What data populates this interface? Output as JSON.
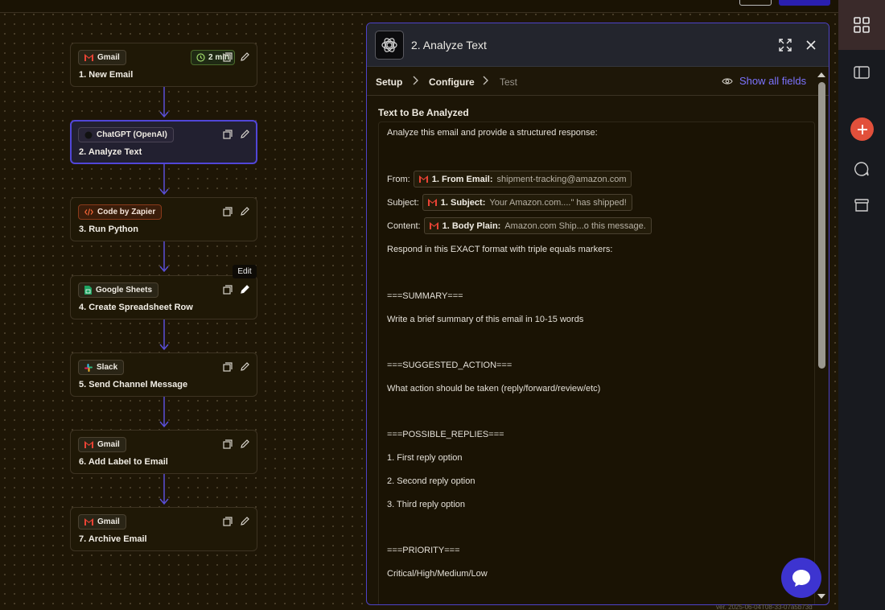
{
  "workflow": {
    "steps": [
      {
        "app": "Gmail",
        "title": "1. New Email",
        "timer": "2 min"
      },
      {
        "app": "ChatGPT (OpenAI)",
        "title": "2. Analyze Text"
      },
      {
        "app": "Code by Zapier",
        "title": "3. Run Python"
      },
      {
        "app": "Google Sheets",
        "title": "4. Create Spreadsheet Row"
      },
      {
        "app": "Slack",
        "title": "5. Send Channel Message"
      },
      {
        "app": "Gmail",
        "title": "6. Add Label to Email"
      },
      {
        "app": "Gmail",
        "title": "7. Archive Email"
      }
    ],
    "tooltip": "Edit"
  },
  "panel": {
    "title": "2. Analyze Text",
    "tabs": [
      "Setup",
      "Configure",
      "Test"
    ],
    "show_all_fields": "Show all fields",
    "field_label": "Text to Be Analyzed",
    "content": {
      "intro": "Analyze this email and provide a structured response:",
      "from_label": "From:",
      "from_token_key": "1. From Email:",
      "from_token_val": "shipment-tracking@amazon.com",
      "subject_label": "Subject:",
      "subject_token_key": "1. Subject:",
      "subject_token_val": "Your Amazon.com....\" has shipped!",
      "content_label": "Content:",
      "content_token_key": "1. Body Plain:",
      "content_token_val": "Amazon.com Ship...o this message.",
      "respond": "Respond in this EXACT format with triple equals markers:",
      "summary_marker": "===SUMMARY===",
      "summary_text": "Write a brief summary of this email in 10-15 words",
      "action_marker": "===SUGGESTED_ACTION===",
      "action_text": "What action should be taken (reply/forward/review/etc)",
      "replies_marker": "===POSSIBLE_REPLIES===",
      "reply1": "1. First reply option",
      "reply2": "2. Second reply option",
      "reply3": "3. Third reply option",
      "priority_marker": "===PRIORITY===",
      "priority_text": "Critical/High/Medium/Low"
    }
  },
  "footer": {
    "version": "ver. 2025-06-04T08-33-07a5b73d"
  },
  "colors": {
    "accent": "#5146d8",
    "link": "#7c73ff",
    "add": "#e2503b"
  }
}
